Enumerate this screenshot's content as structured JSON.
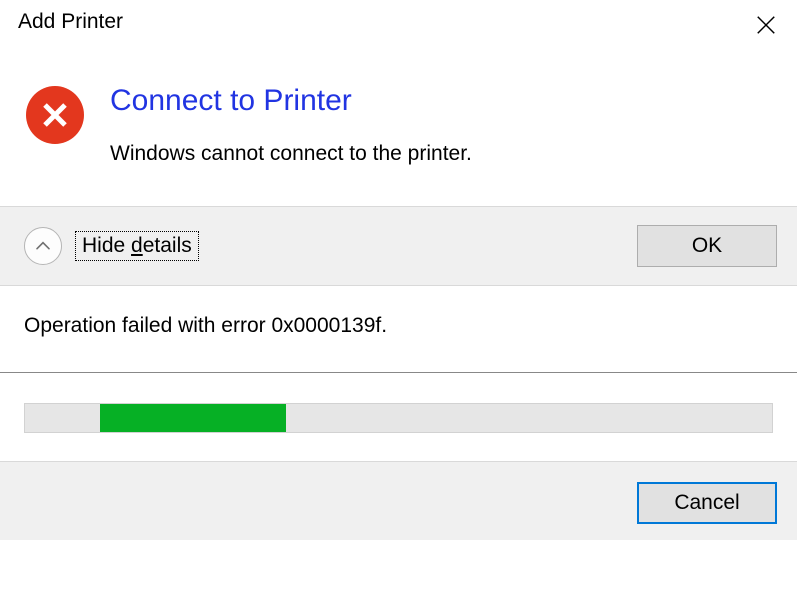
{
  "window": {
    "title": "Add Printer"
  },
  "dialog": {
    "heading": "Connect to Printer",
    "message": "Windows cannot connect to the printer."
  },
  "actions": {
    "hide_details_prefix": "Hide ",
    "hide_details_underline": "d",
    "hide_details_suffix": "etails",
    "ok_label": "OK"
  },
  "details": {
    "text": "Operation failed with error 0x0000139f."
  },
  "progress": {
    "fill_left_percent": 10,
    "fill_width_percent": 25
  },
  "bottom": {
    "cancel_label": "Cancel"
  }
}
